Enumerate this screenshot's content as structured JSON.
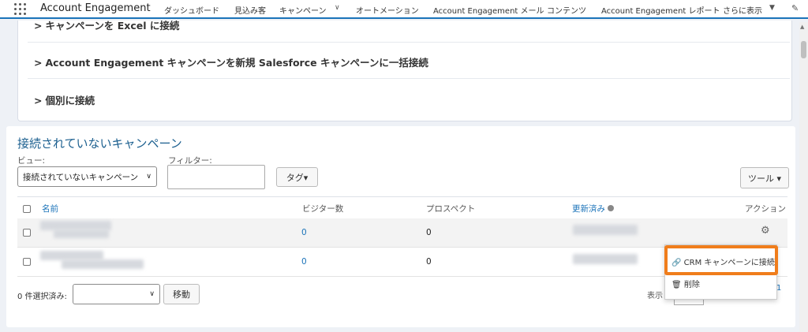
{
  "nav": {
    "app_name": "Account Engagement",
    "items": [
      "ダッシュボード",
      "見込み客",
      "キャンペーン",
      "オートメーション",
      "Account Engagement メール",
      "コンテンツ",
      "Account Engagement レポート",
      "さらに表示"
    ],
    "icons": {
      "launcher": "app-launcher-icon",
      "edit": "pencil-icon"
    }
  },
  "accordion": {
    "rows": [
      "キャンペーンを Excel に接続",
      "Account Engagement キャンペーンを新規 Salesforce キャンペーンに一括接続",
      "個別に接続"
    ]
  },
  "section": {
    "title": "接続されていないキャンペーン",
    "view_label": "ビュー:",
    "view_value": "接続されていないキャンペーン",
    "filter_label": "フィルター:",
    "tag_button": "タグ▾",
    "tools_button": "ツール ▾"
  },
  "table": {
    "headers": {
      "name": "名前",
      "visitors": "ビジター数",
      "prospects": "プロスペクト",
      "updated": "更新済み",
      "action": "アクション"
    },
    "rows": [
      {
        "visitors": "0",
        "prospects": "0"
      },
      {
        "visitors": "0",
        "prospects": "0"
      }
    ]
  },
  "footer": {
    "selected_label": "0 件選択済み:",
    "move_button": "移動",
    "display_label": "表示",
    "page_number": "1"
  },
  "action_menu": {
    "connect_crm": "CRM キャンペーンに接続",
    "delete": "削除"
  },
  "colors": {
    "accent_blue": "#1b73b9",
    "highlight_orange": "#f07d1b"
  }
}
